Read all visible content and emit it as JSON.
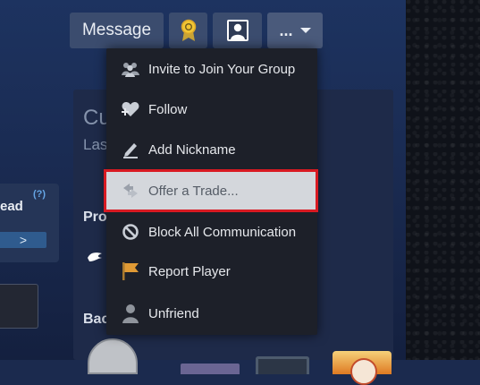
{
  "header": {
    "message_label": "Message",
    "more_label": "..."
  },
  "left": {
    "label": "ead",
    "help": "(?)",
    "arrow": ">"
  },
  "center": {
    "title": "Cu",
    "subtitle": "Las",
    "section1": "Pro",
    "section2": "Bac"
  },
  "menu": {
    "items": [
      {
        "label": "Invite to Join Your Group",
        "icon": "group-icon"
      },
      {
        "label": "Follow",
        "icon": "heart-plus-icon"
      },
      {
        "label": "Add Nickname",
        "icon": "pencil-icon"
      },
      {
        "label": "Offer a Trade...",
        "icon": "trade-icon"
      },
      {
        "label": "Block All Communication",
        "icon": "block-icon"
      },
      {
        "label": "Report Player",
        "icon": "flag-icon"
      },
      {
        "label": "Unfriend",
        "icon": "person-icon"
      }
    ]
  },
  "colors": {
    "menu_bg": "#1d2029",
    "highlight_bg": "#d4d7dc",
    "highlight_border": "#d81a22",
    "button_bg": "#3b4c6e"
  }
}
